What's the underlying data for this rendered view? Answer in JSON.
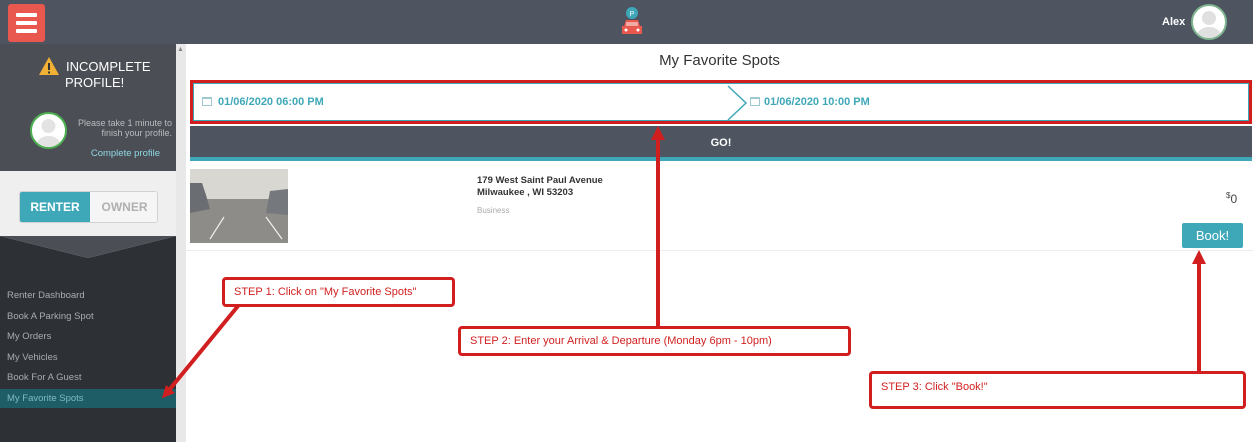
{
  "header": {
    "menu_icon": "hamburger-icon",
    "logo_icon": "parking-car-logo-icon",
    "user_name": "Alex"
  },
  "sidebar": {
    "warning_title_line1": "INCOMPLETE",
    "warning_title_line2": "PROFILE!",
    "profile_message": "Please take 1 minute to finish your profile.",
    "complete_profile_link": "Complete profile",
    "role_toggle": {
      "renter": "RENTER",
      "owner": "OWNER",
      "selected": "RENTER"
    },
    "nav_items": [
      {
        "label": "Renter Dashboard",
        "active": false
      },
      {
        "label": "Book A Parking Spot",
        "active": false
      },
      {
        "label": "My Orders",
        "active": false
      },
      {
        "label": "My Vehicles",
        "active": false
      },
      {
        "label": "Book For A Guest",
        "active": false
      },
      {
        "label": "My Favorite Spots",
        "active": true
      }
    ]
  },
  "main": {
    "title": "My Favorite Spots",
    "arrival": "01/06/2020 06:00 PM",
    "departure": "01/06/2020 10:00 PM",
    "go_label": "GO!",
    "spot": {
      "address_line1": "179 West Saint Paul Avenue",
      "address_line2": "Milwaukee , WI 53203",
      "type": "Business",
      "price_symbol": "$",
      "price": "0",
      "book_label": "Book!"
    }
  },
  "annotations": {
    "step1": "STEP 1: Click on \"My Favorite Spots\"",
    "step2": "STEP 2: Enter your Arrival & Departure (Monday 6pm - 10pm)",
    "step3": "STEP 3: Click \"Book!\""
  },
  "colors": {
    "accent": "#3fa8b8",
    "header": "#4e5561",
    "annotation": "#d11f1f",
    "menu_button": "#e9584f"
  }
}
